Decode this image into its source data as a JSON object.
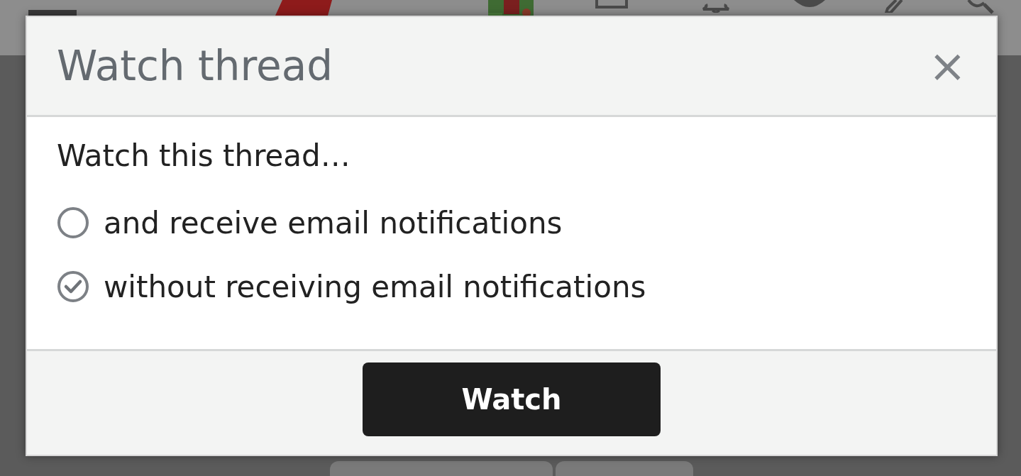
{
  "dialog": {
    "title": "Watch thread",
    "close": "×",
    "prompt": "Watch this thread…",
    "options": [
      {
        "label": "and receive email notifications",
        "selected": false
      },
      {
        "label": "without receiving email notifications",
        "selected": true
      }
    ],
    "button": "Watch"
  }
}
